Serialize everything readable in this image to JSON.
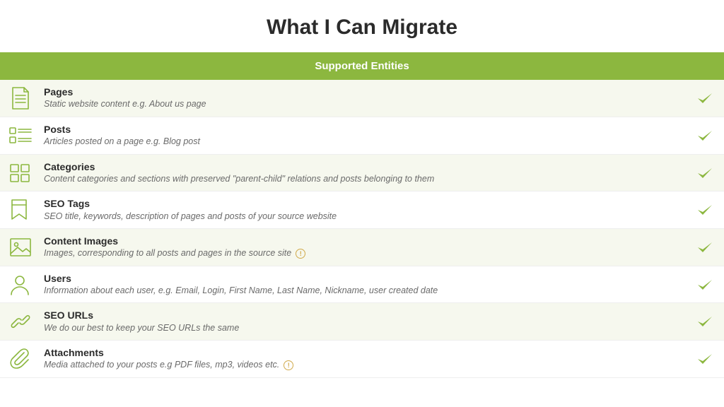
{
  "page_title": "What I Can Migrate",
  "table_header": "Supported Entities",
  "entities": [
    {
      "icon": "page",
      "title": "Pages",
      "desc": "Static website content e.g. About us page",
      "info": false,
      "supported": true
    },
    {
      "icon": "posts",
      "title": "Posts",
      "desc": "Articles posted on a page e.g. Blog post",
      "info": false,
      "supported": true
    },
    {
      "icon": "categories",
      "title": "Categories",
      "desc": "Content categories and sections with preserved \"parent-child\" relations and posts belonging to them",
      "info": false,
      "supported": true
    },
    {
      "icon": "seotags",
      "title": "SEO Tags",
      "desc": "SEO title, keywords, description of pages and posts of your source website",
      "info": false,
      "supported": true
    },
    {
      "icon": "images",
      "title": "Content Images",
      "desc": "Images, corresponding to all posts and pages in the source site",
      "info": true,
      "supported": true
    },
    {
      "icon": "users",
      "title": "Users",
      "desc": "Information about each user, e.g. Email, Login, First Name, Last Name, Nickname, user created date",
      "info": false,
      "supported": true
    },
    {
      "icon": "seourls",
      "title": "SEO URLs",
      "desc": "We do our best to keep your SEO URLs the same",
      "info": false,
      "supported": true
    },
    {
      "icon": "attachments",
      "title": "Attachments",
      "desc": "Media attached to your posts e.g PDF files, mp3, videos etc.",
      "info": true,
      "supported": true
    }
  ]
}
